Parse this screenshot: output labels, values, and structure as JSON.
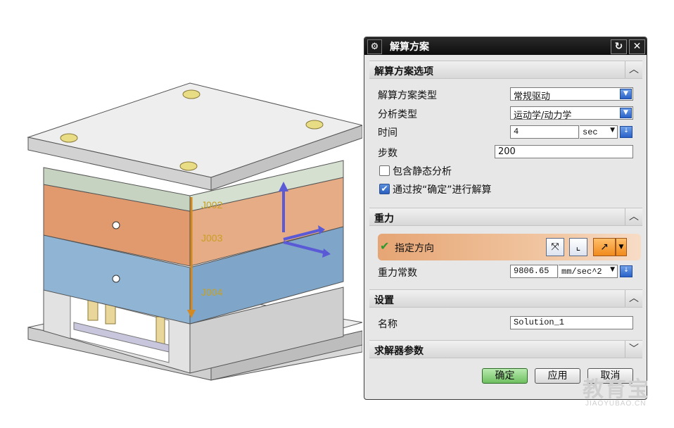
{
  "viewport": {
    "joint_labels": [
      "J002",
      "J003",
      "J004"
    ]
  },
  "dialog": {
    "title": "解算方案",
    "sections": {
      "options": {
        "title": "解算方案选项",
        "solution_type_label": "解算方案类型",
        "solution_type_value": "常规驱动",
        "analysis_type_label": "分析类型",
        "analysis_type_value": "运动学/动力学",
        "time_label": "时间",
        "time_value": "4",
        "time_unit": "sec",
        "steps_label": "步数",
        "steps_value": "200",
        "static_analysis_label": "包含静态分析",
        "static_analysis_checked": false,
        "solve_on_ok_label": "通过按“确定”进行解算",
        "solve_on_ok_checked": true
      },
      "gravity": {
        "title": "重力",
        "direction_label": "指定方向",
        "constant_label": "重力常数",
        "constant_value": "9806.65",
        "constant_unit": "mm/sec^2"
      },
      "settings": {
        "title": "设置",
        "name_label": "名称",
        "name_value": "Solution_1"
      },
      "solver": {
        "title": "求解器参数"
      }
    },
    "buttons": {
      "ok": "确定",
      "apply": "应用",
      "cancel": "取消"
    }
  },
  "watermark": {
    "text": "教育宝",
    "url": "JIAOYUBAO.CN"
  }
}
